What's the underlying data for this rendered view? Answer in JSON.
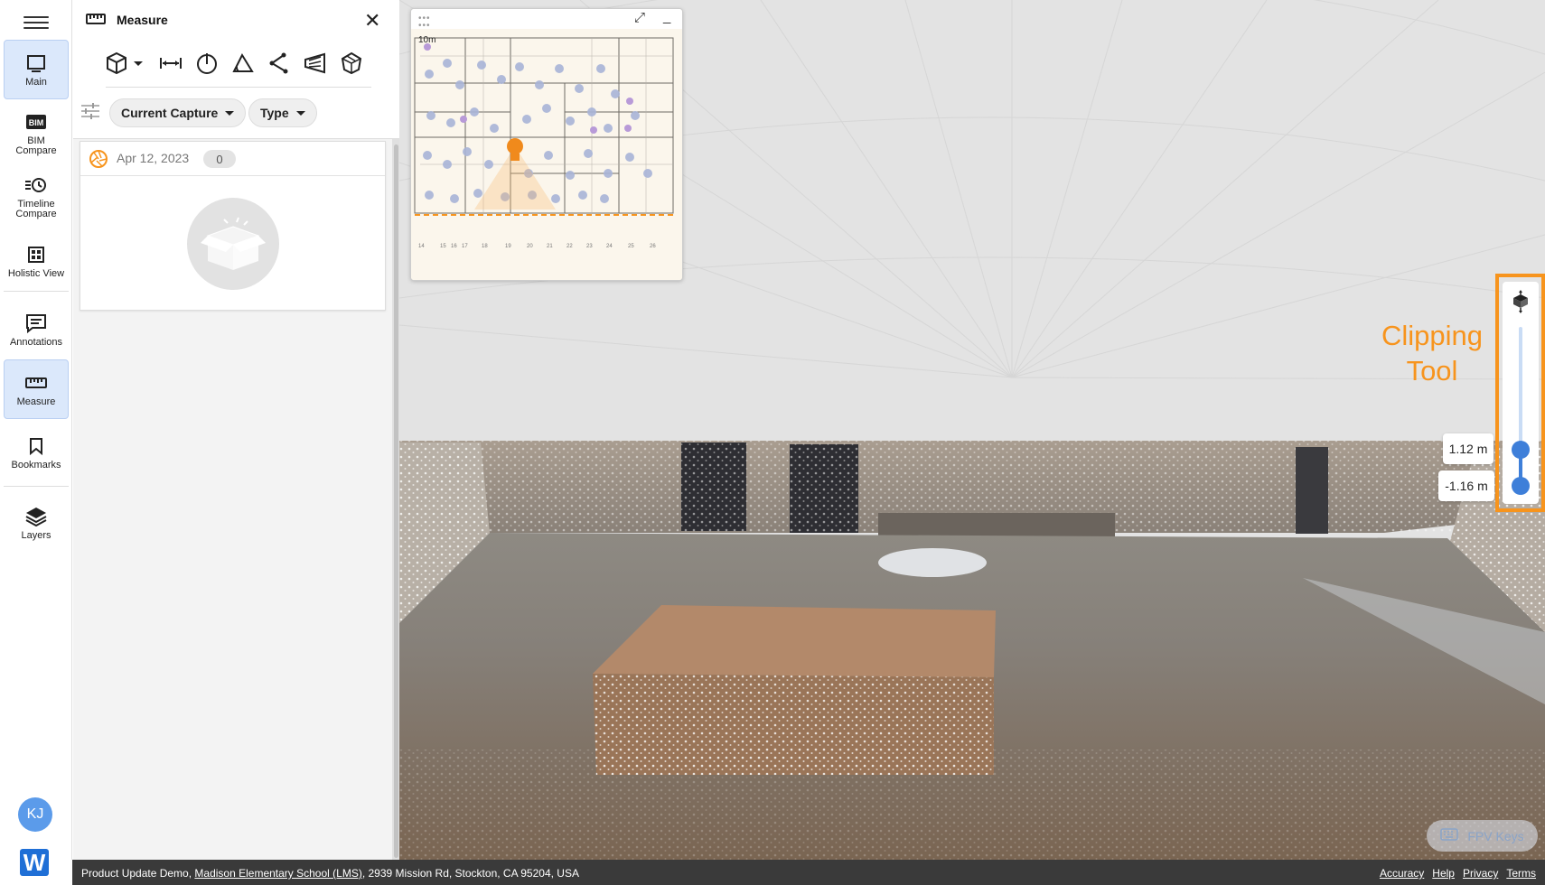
{
  "rail": {
    "items": [
      {
        "id": "main",
        "label": "Main"
      },
      {
        "id": "bim",
        "label_line1": "BIM",
        "label_line2": "Compare"
      },
      {
        "id": "timeline",
        "label_line1": "Timeline",
        "label_line2": "Compare"
      },
      {
        "id": "holistic",
        "label": "Holistic View"
      },
      {
        "id": "annotations",
        "label": "Annotations"
      },
      {
        "id": "measure",
        "label": "Measure"
      },
      {
        "id": "bookmarks",
        "label": "Bookmarks"
      },
      {
        "id": "layers",
        "label": "Layers"
      }
    ],
    "avatar_initials": "KJ",
    "logo_letter": "W"
  },
  "panel": {
    "title": "Measure",
    "chips": {
      "capture": "Current Capture",
      "type": "Type"
    },
    "capture": {
      "date": "Apr 12, 2023",
      "count": "0"
    }
  },
  "minimap": {
    "scale_label": "10m"
  },
  "clipping": {
    "label_line1": "Clipping",
    "label_line2": "Tool",
    "top_value": "1.12 m",
    "bottom_value": "-1.16 m",
    "accent": "#f7941d",
    "slider_color": "#3e7fd9"
  },
  "fpv_label": "FPV Keys",
  "footer": {
    "prefix": "Product Update Demo, ",
    "project_link": "Madison Elementary School (LMS)",
    "address": ", 2939 Mission Rd, Stockton, CA 95204, USA",
    "links": [
      "Accuracy",
      "Help",
      "Privacy",
      "Terms"
    ]
  }
}
